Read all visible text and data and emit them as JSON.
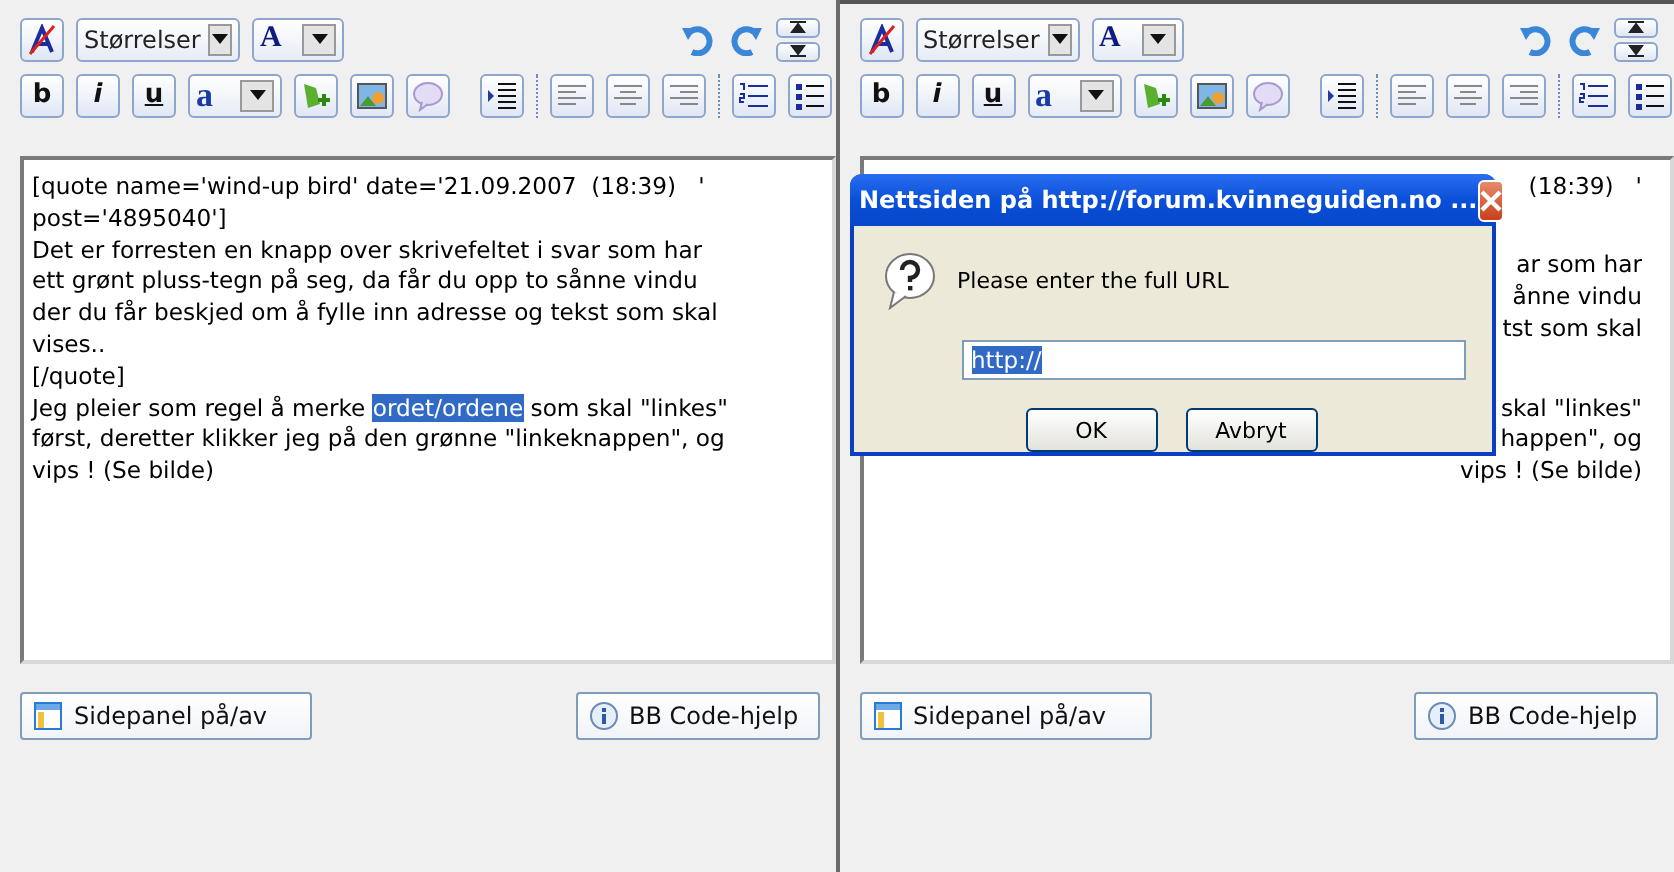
{
  "panels": [
    {
      "toolbar": {
        "size_select": "Størrelser",
        "color_select": "A",
        "format_buttons": [
          "b",
          "i",
          "u"
        ],
        "style_select": "a"
      },
      "editor": {
        "lines": [
          [
            {
              "text": "[quote name='wind-up bird' date='21.09.2007  (18:39)   '",
              "selected": false
            }
          ],
          [
            {
              "text": "post='4895040']",
              "selected": false
            }
          ],
          [
            {
              "text": "Det er forresten en knapp over skrivefeltet i svar som har",
              "selected": false
            }
          ],
          [
            {
              "text": "ett grønt pluss-tegn på seg, da får du opp to sånne vindu",
              "selected": false
            }
          ],
          [
            {
              "text": "der du får beskjed om å fylle inn adresse og tekst som skal",
              "selected": false
            }
          ],
          [
            {
              "text": "vises..",
              "selected": false
            }
          ],
          [
            {
              "text": "[/quote]",
              "selected": false
            }
          ],
          [
            {
              "text": "Jeg pleier som regel å merke ",
              "selected": false
            },
            {
              "text": "ordet/ordene",
              "selected": true
            },
            {
              "text": " som skal \"linkes\"",
              "selected": false
            }
          ],
          [
            {
              "text": "først, deretter klikker jeg på den grønne \"linkeknappen\", og",
              "selected": false
            }
          ],
          [
            {
              "text": "vips ! (Se bilde)",
              "selected": false
            }
          ]
        ]
      },
      "buttons": [
        "Sidepanel på/av",
        "BB Code-hjelp"
      ]
    },
    {
      "toolbar": {
        "size_select": "Størrelser",
        "color_select": "A",
        "format_buttons": [
          "b",
          "i",
          "u"
        ],
        "style_select": "a"
      },
      "editor": {
        "visible_fragment_groups": [
          [
            "(18:39)   '"
          ],
          [
            "ar som har",
            "ånne vindu",
            "tst som skal"
          ],
          [
            "skal \"linkes\"",
            "happen\", og",
            "vips ! (Se bilde)"
          ]
        ]
      },
      "buttons": [
        "Sidepanel på/av",
        "BB Code-hjelp"
      ],
      "dialog": {
        "title": "Nettsiden på http://forum.kvinneguiden.no ...",
        "message": "Please enter the full URL",
        "input": {
          "value": "http://",
          "value_selected": true
        },
        "buttons": [
          "OK",
          "Avbryt"
        ]
      }
    }
  ]
}
